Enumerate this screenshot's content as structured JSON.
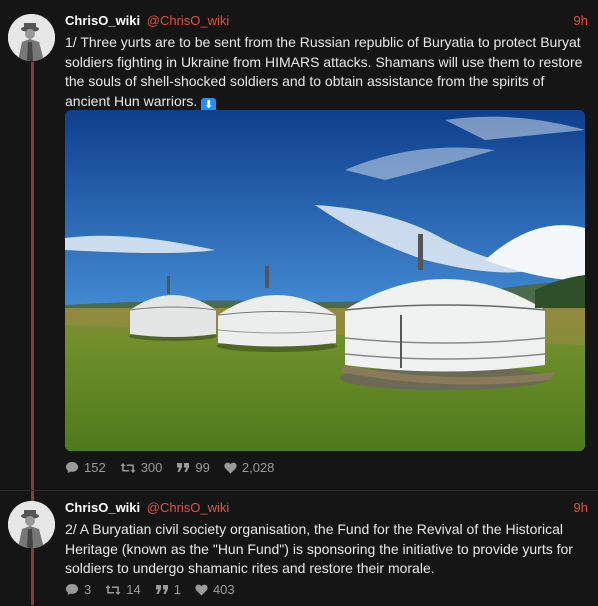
{
  "tweets": [
    {
      "display_name": "ChrisO_wiki",
      "handle": "@ChrisO_wiki",
      "time": "9h",
      "text": "1/ Three yurts are to be sent from the Russian republic of Buryatia to protect Buryat soldiers fighting in Ukraine from HIMARS attacks. Shamans will use them to restore the souls of shell-shocked soldiers and to obtain assistance from the spirits of ancient Hun warriors.",
      "emoji": "⬇",
      "has_image": true,
      "stats": {
        "replies": "152",
        "retweets": "300",
        "quotes": "99",
        "likes": "2,028"
      }
    },
    {
      "display_name": "ChrisO_wiki",
      "handle": "@ChrisO_wiki",
      "time": "9h",
      "text": "2/ A Buryatian civil society organisation, the Fund for the Revival of the Historical Heritage (known as the \"Hun Fund\") is sponsoring the initiative to provide yurts for soldiers to undergo shamanic rites and restore their morale.",
      "has_image": false,
      "stats": {
        "replies": "3",
        "retweets": "14",
        "quotes": "1",
        "likes": "403"
      }
    }
  ],
  "icons": [
    "reply-icon",
    "retweet-icon",
    "quote-icon",
    "like-icon"
  ],
  "colors": {
    "background": "#151515",
    "accent": "#e0533f",
    "thread_line": "#8a3a38"
  }
}
